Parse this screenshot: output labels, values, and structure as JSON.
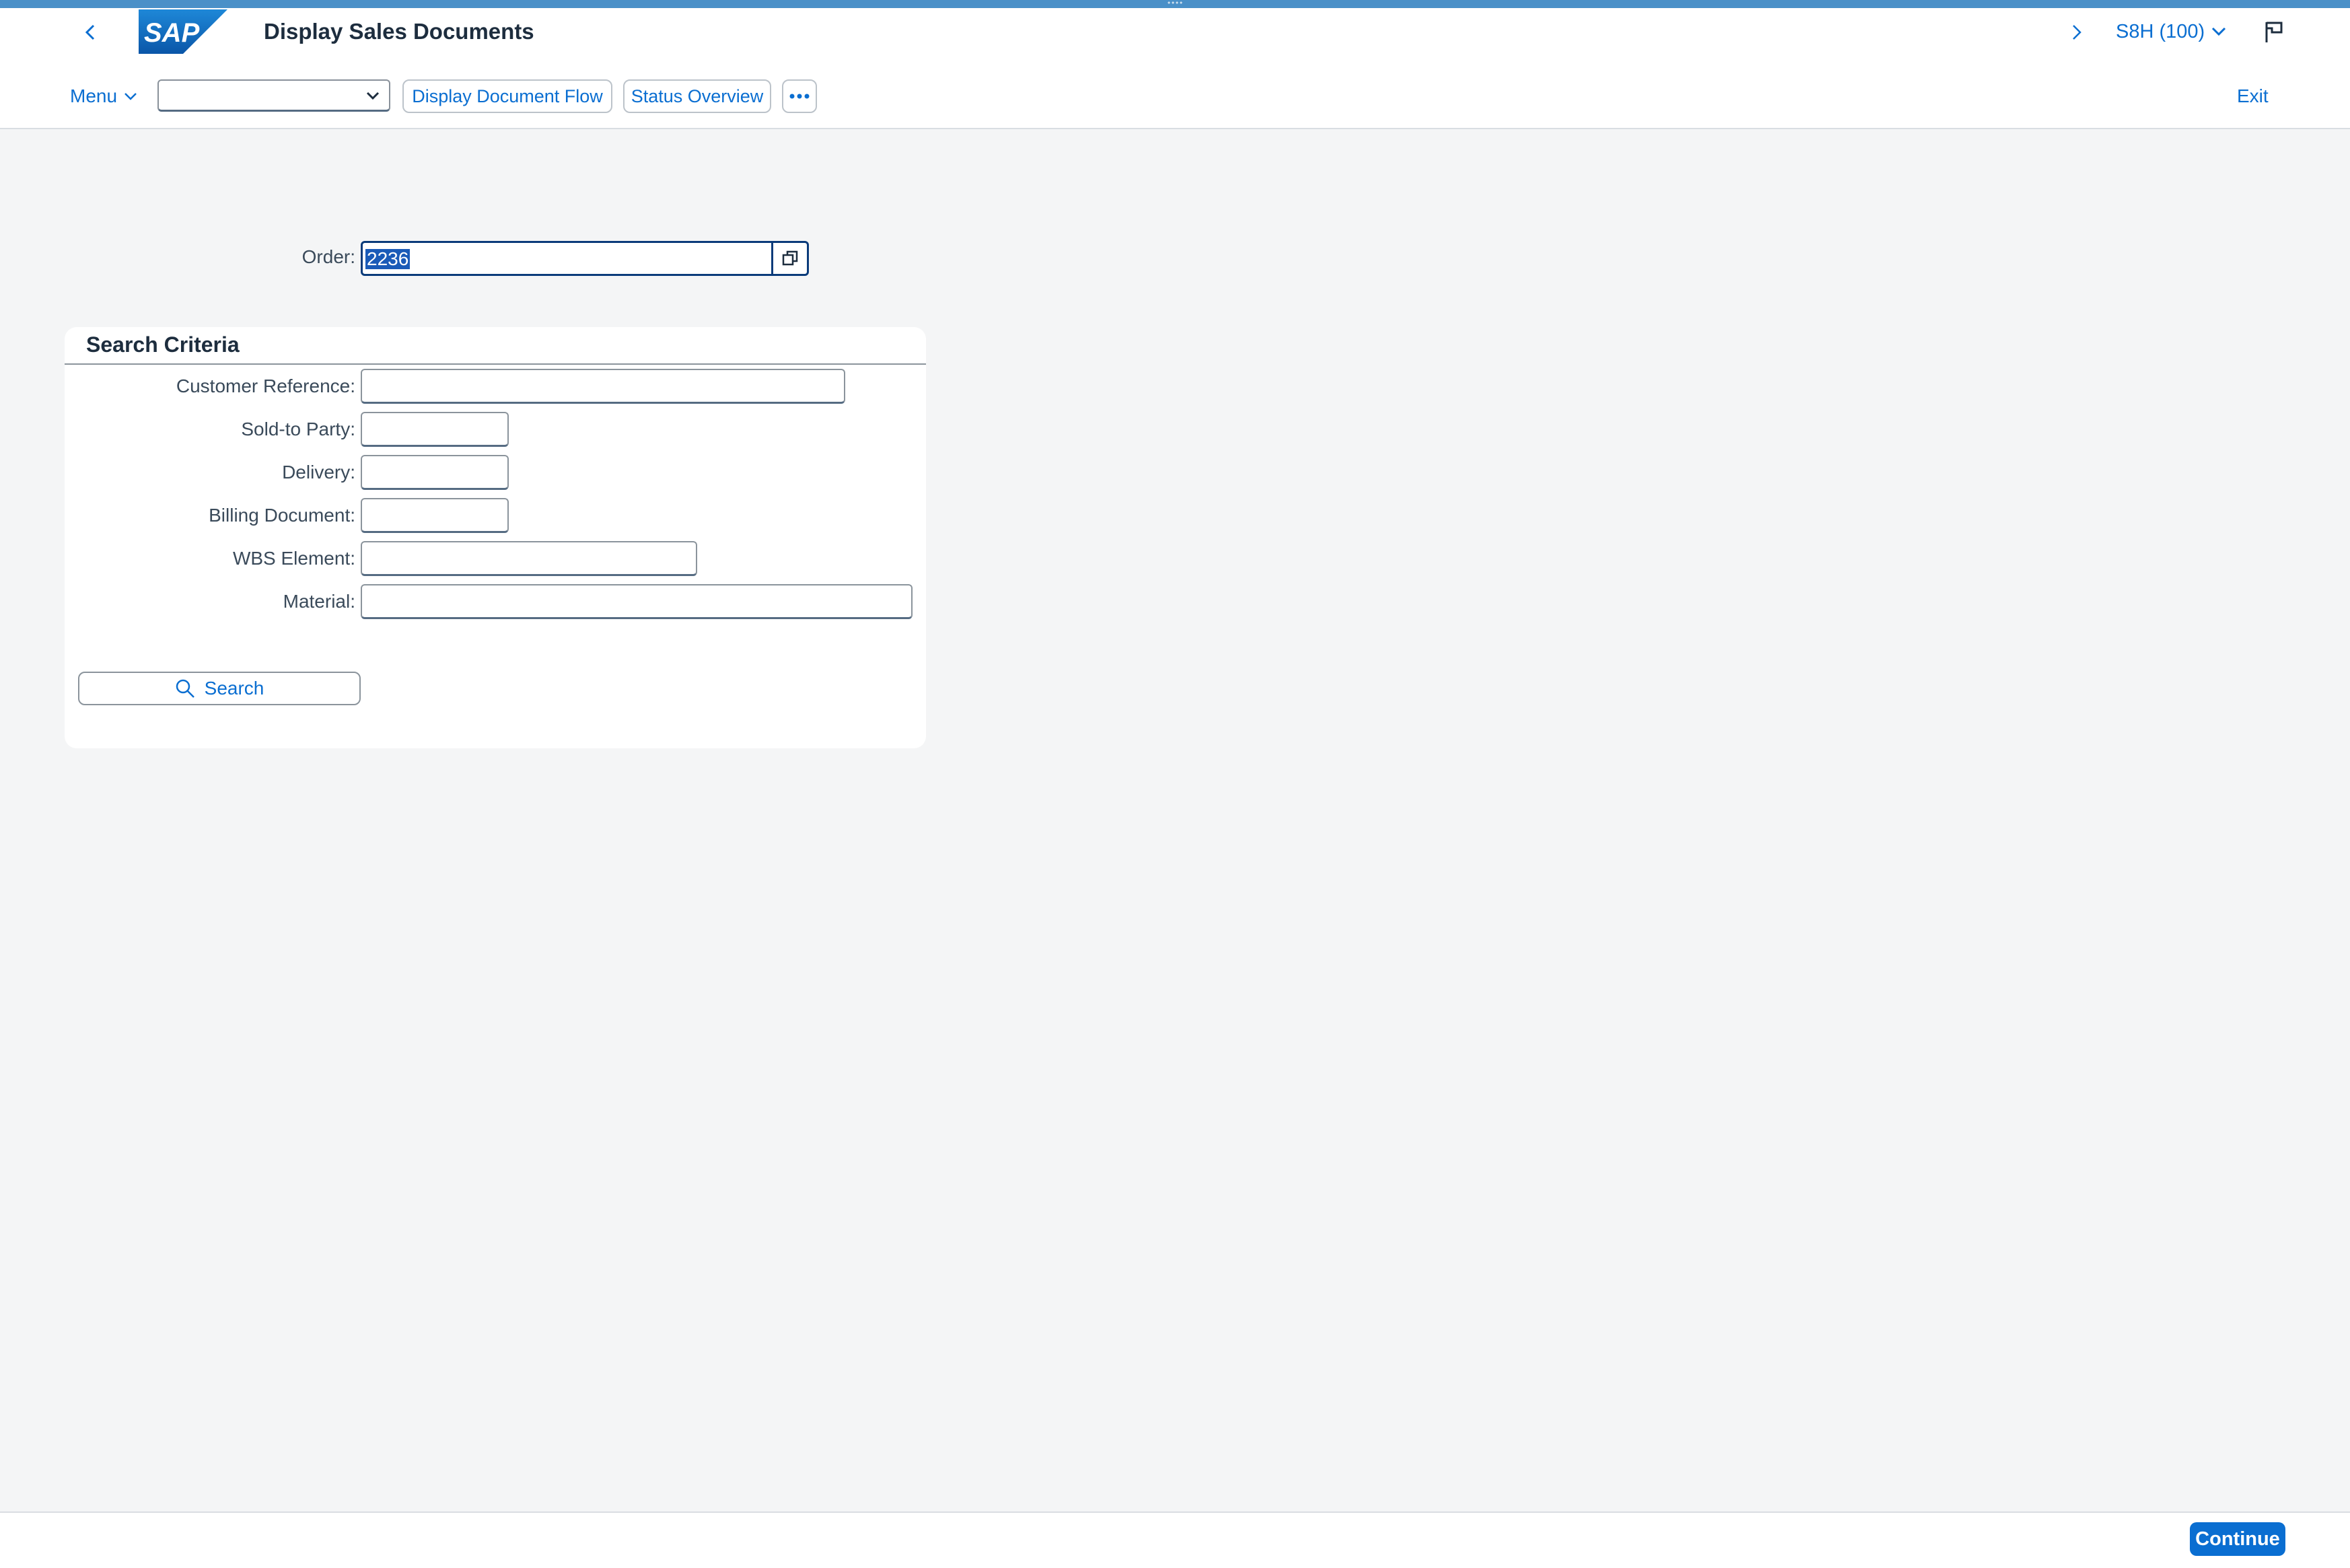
{
  "header": {
    "title": "Display Sales Documents",
    "system": "S8H (100)",
    "logo_text": "SAP"
  },
  "toolbar": {
    "menu_label": "Menu",
    "dropdown_value": "",
    "display_document_flow": "Display Document Flow",
    "status_overview": "Status Overview",
    "exit_label": "Exit"
  },
  "order": {
    "label": "Order:",
    "value": "2236"
  },
  "search_criteria": {
    "title": "Search Criteria",
    "fields": [
      {
        "label": "Customer Reference:",
        "value": ""
      },
      {
        "label": "Sold-to Party:",
        "value": ""
      },
      {
        "label": "Delivery:",
        "value": ""
      },
      {
        "label": "Billing Document:",
        "value": ""
      },
      {
        "label": "WBS Element:",
        "value": ""
      },
      {
        "label": "Material:",
        "value": ""
      }
    ],
    "search_button": "Search"
  },
  "footer": {
    "continue_label": "Continue"
  },
  "colors": {
    "accent": "#0a6ed1",
    "top_bar": "#4a90c8",
    "background": "#f4f5f6",
    "selection": "#1a5bb8"
  }
}
